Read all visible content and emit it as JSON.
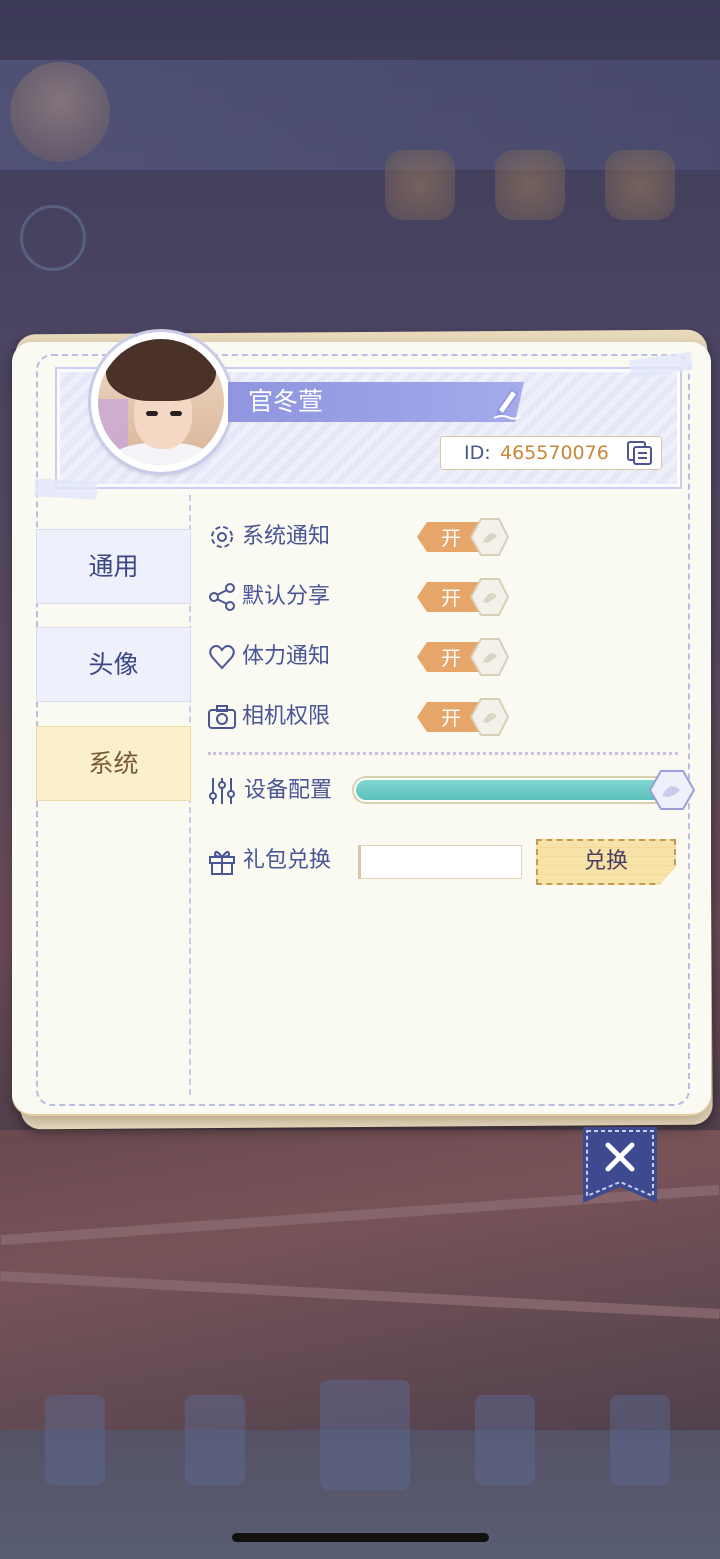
{
  "profile": {
    "name": "官冬萱",
    "id_label": "ID:",
    "id_value": "465570076"
  },
  "tabs": [
    {
      "label": "通用",
      "active": false
    },
    {
      "label": "头像",
      "active": false
    },
    {
      "label": "系统",
      "active": true
    }
  ],
  "settings": [
    {
      "label": "系统通知",
      "icon": "gear-icon",
      "toggle_label": "开",
      "on": true
    },
    {
      "label": "默认分享",
      "icon": "share-icon",
      "toggle_label": "开",
      "on": true
    },
    {
      "label": "体力通知",
      "icon": "heart-icon",
      "toggle_label": "开",
      "on": true
    },
    {
      "label": "相机权限",
      "icon": "camera-icon",
      "toggle_label": "开",
      "on": true
    }
  ],
  "device_config": {
    "label": "设备配置",
    "icon": "sliders-icon",
    "level": 0.98
  },
  "gift": {
    "label": "礼包兑换",
    "icon": "gift-icon",
    "input_value": "",
    "button_label": "兑换"
  },
  "colors": {
    "accent": "#8f95df",
    "toggle_on": "#e6a66a",
    "slider": "#5cc0bb",
    "id_value": "#c8873a"
  }
}
